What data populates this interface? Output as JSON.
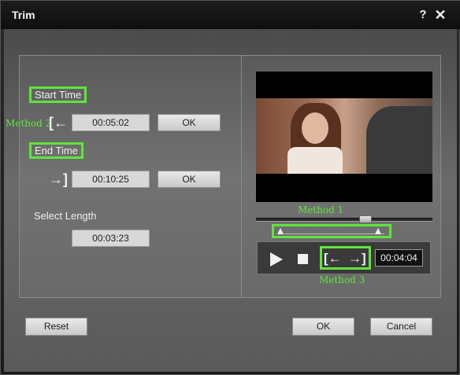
{
  "window": {
    "title": "Trim",
    "help_label": "?",
    "close_label": "✕"
  },
  "left": {
    "start_time_label": "Start Time",
    "start_time_value": "00:05:02",
    "start_ok_label": "OK",
    "end_time_label": "End Time",
    "end_time_value": "00:10:25",
    "end_ok_label": "OK",
    "select_length_label": "Select Length",
    "select_length_value": "00:03:23"
  },
  "annotations": {
    "method1": "Method 1",
    "method2": "Method 2",
    "method3": "Method 3"
  },
  "icons": {
    "set_start": "set-start-icon",
    "set_end": "set-end-icon",
    "play": "play-icon",
    "stop": "stop-icon"
  },
  "player": {
    "current_time": "00:04:04"
  },
  "footer": {
    "reset_label": "Reset",
    "ok_label": "OK",
    "cancel_label": "Cancel"
  },
  "colors": {
    "highlight": "#5fe63a"
  }
}
